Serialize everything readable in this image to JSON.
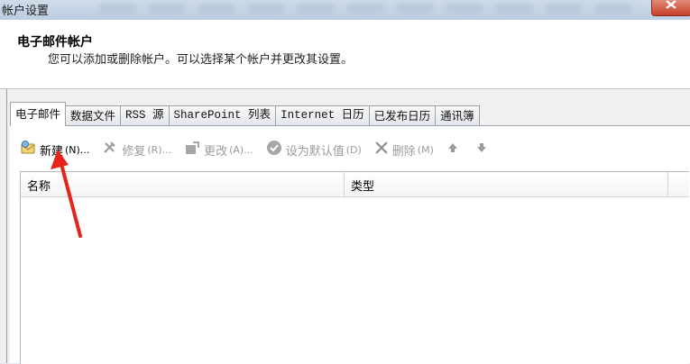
{
  "window": {
    "title": "帐户设置"
  },
  "header": {
    "title": "电子邮件帐户",
    "description": "您可以添加或删除帐户。可以选择某个帐户并更改其设置。"
  },
  "tabs": [
    {
      "label": "电子邮件",
      "active": true
    },
    {
      "label": "数据文件"
    },
    {
      "label": "RSS 源"
    },
    {
      "label": "SharePoint 列表"
    },
    {
      "label": "Internet 日历"
    },
    {
      "label": "已发布日历"
    },
    {
      "label": "通讯簿"
    }
  ],
  "toolbar": {
    "new_label": "新建",
    "new_shortcut": "(N)...",
    "repair_label": "修复",
    "repair_shortcut": "(R)...",
    "change_label": "更改",
    "change_shortcut": "(A)...",
    "default_label": "设为默认值",
    "default_shortcut": "(D)",
    "remove_label": "删除",
    "remove_shortcut": "(M)"
  },
  "list": {
    "columns": [
      "名称",
      "类型"
    ],
    "rows": []
  },
  "colors": {
    "annotation_arrow": "#e8231c",
    "title_bar": "#c5d4e4",
    "close_button": "#c7402a"
  }
}
